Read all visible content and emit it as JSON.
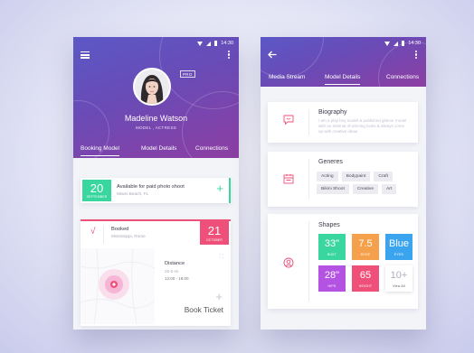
{
  "status": {
    "time": "14:30"
  },
  "profile": {
    "badge": "PRO",
    "name": "Madeline Watson",
    "role": "MODEL , ACTRESS",
    "tabs": [
      "Booking Model",
      "Model Details",
      "Connections"
    ]
  },
  "availability": {
    "day": "20",
    "month": "SEPTEMBER",
    "title": "Available for paid photo shoot",
    "location": "Miami Beach, FL",
    "plus": "+"
  },
  "booked": {
    "check": "√",
    "title": "Booked",
    "location": "Mississippi, Rome",
    "day": "21",
    "month": "OCTOBER",
    "distance_label": "Distance",
    "distance_value": "20.6 mi",
    "time_range": "12:00 - 18:00",
    "plus": "+",
    "button": "Book Ticket"
  },
  "details": {
    "tabs": [
      "Media Stream",
      "Model Details",
      "Connections"
    ],
    "biography": {
      "title": "Biography",
      "text": "I am a play boy model & published glamor model with an arsenal of winning looks & always come up with creative ideas"
    },
    "generes": {
      "title": "Generes",
      "tags": [
        "Acting",
        "Bodypaint",
        "Craft",
        "Bikini Shoot",
        "Creative",
        "Art"
      ]
    },
    "shapes": {
      "title": "Shapes",
      "tiles": [
        {
          "value": "33\"",
          "label": "BUST",
          "color": "#3ad6a0"
        },
        {
          "value": "7.5",
          "label": "SHOE",
          "color": "#f5a04a"
        },
        {
          "value": "Blue",
          "label": "EYES",
          "color": "#3aa4ef"
        },
        {
          "value": "28\"",
          "label": "HIPS",
          "color": "#b452e2"
        },
        {
          "value": "65",
          "label": "HEIGHT",
          "color": "#ef5079"
        },
        {
          "value": "10+",
          "label": "View All",
          "color": "#ffffff"
        }
      ]
    }
  }
}
